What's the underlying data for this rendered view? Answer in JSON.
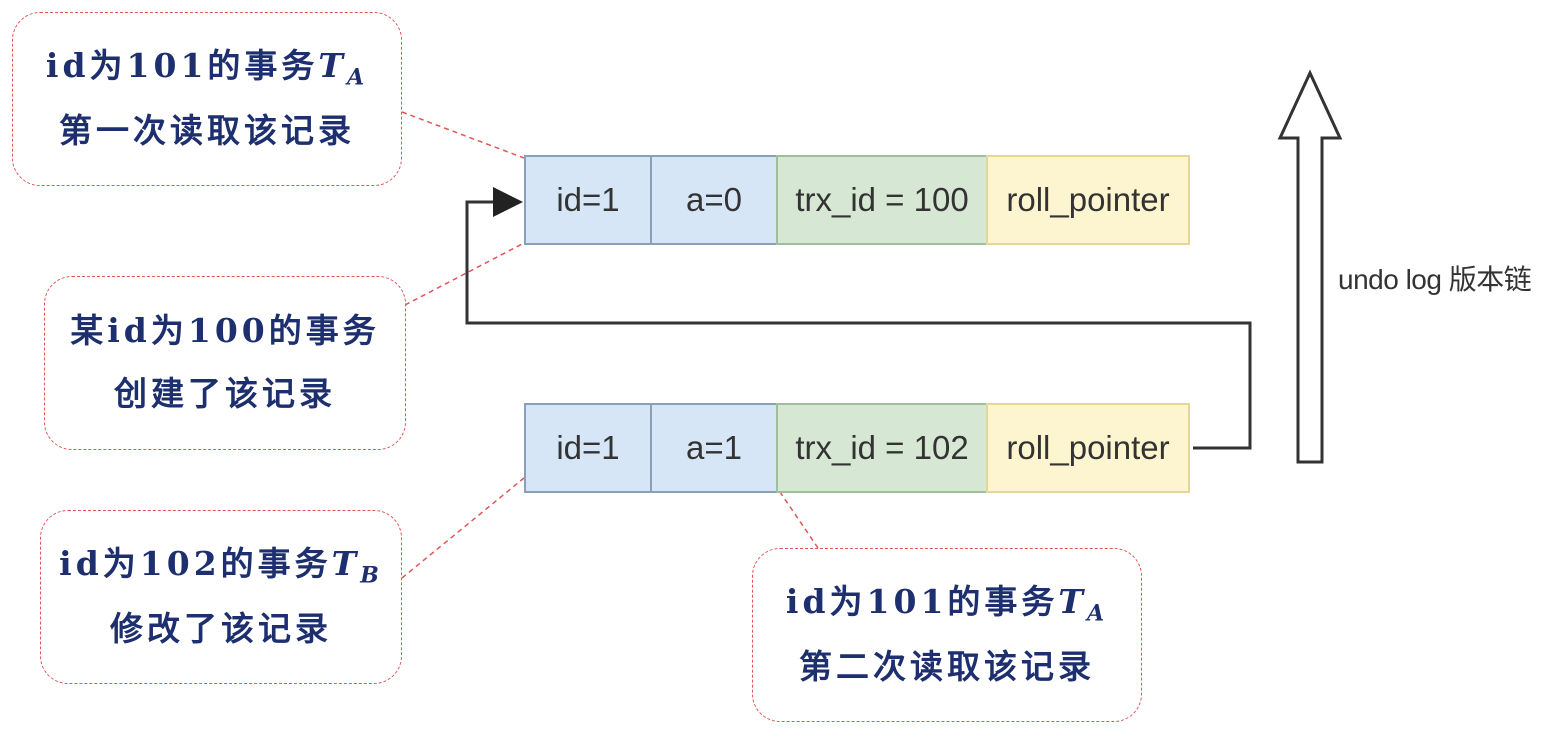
{
  "records": [
    {
      "id": "record-1",
      "cells": [
        {
          "text": "id=1",
          "kind": "blue"
        },
        {
          "text": "a=0",
          "kind": "blue"
        },
        {
          "text": "trx_id = 100",
          "kind": "green"
        },
        {
          "text": "roll_pointer",
          "kind": "yellow"
        }
      ]
    },
    {
      "id": "record-2",
      "cells": [
        {
          "text": "id=1",
          "kind": "blue"
        },
        {
          "text": "a=1",
          "kind": "blue"
        },
        {
          "text": "trx_id = 102",
          "kind": "green"
        },
        {
          "text": "roll_pointer",
          "kind": "yellow"
        }
      ]
    }
  ],
  "undo_label": "undo log 版本链",
  "callouts": {
    "ta_first": {
      "line1_pre": "id为101的事务",
      "line1_var": "T",
      "line1_sub": "A",
      "line2": "第一次读取该记录"
    },
    "tx100": {
      "line1": "某id为100的事务",
      "line2": "创建了该记录"
    },
    "tb": {
      "line1_pre": "id为102的事务",
      "line1_var": "T",
      "line1_sub": "B",
      "line2": "修改了该记录"
    },
    "ta_second": {
      "line1_pre": "id为101的事务",
      "line1_var": "T",
      "line1_sub": "A",
      "line2": "第二次读取该记录"
    }
  },
  "colors": {
    "cell_blue": "#d7e6f6",
    "cell_green": "#d6e8d3",
    "cell_yellow": "#fdf5cf",
    "callout_border": "#e05555",
    "callout_text": "#1d2f6e",
    "connector": "#333333"
  }
}
